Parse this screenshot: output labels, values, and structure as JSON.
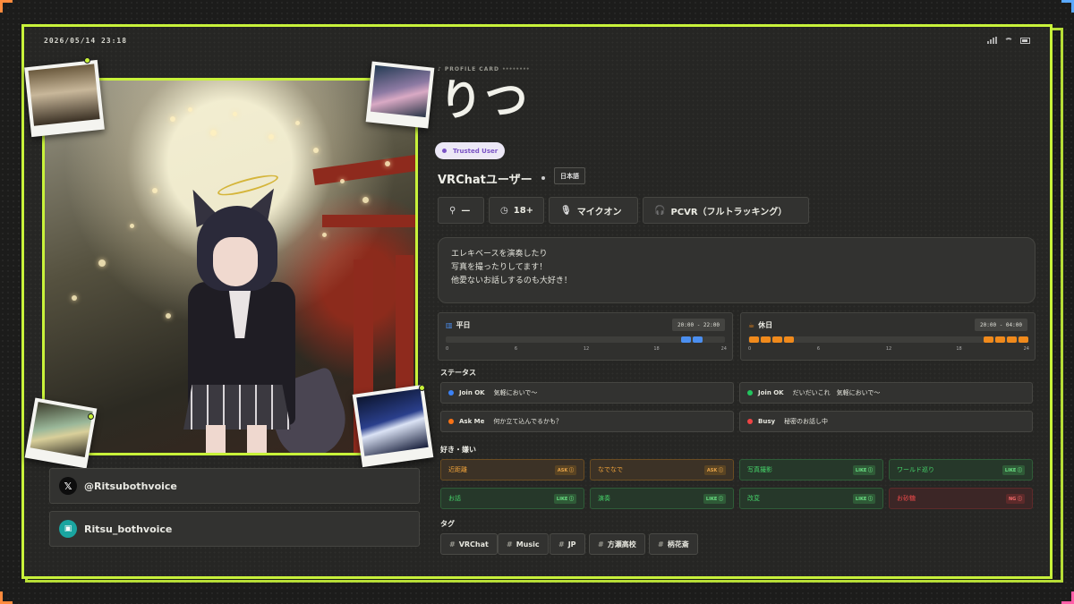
{
  "status_bar": {
    "time": "2026/05/14 23:18"
  },
  "kicker": "PROFILE CARD",
  "name": "りつ",
  "trust_badge": "Trusted User",
  "role": "VRChatユーザー",
  "language": "日本語",
  "chips": [
    {
      "icon": "person-icon",
      "label": "—"
    },
    {
      "icon": "age-icon",
      "label": "18+"
    },
    {
      "icon": "microphone-icon",
      "label": "マイクオン"
    },
    {
      "icon": "headset-icon",
      "label": "PCVR（フルトラッキング）"
    }
  ],
  "bio": [
    "エレキベースを演奏したり",
    "写真を撮ったりしてます！",
    "他愛ないお話しするのも大好き！"
  ],
  "schedule": {
    "weekday": {
      "label": "平日",
      "time": "20:00 - 22:00",
      "color": "#4b8ff0",
      "ranges": [
        [
          20,
          22
        ]
      ]
    },
    "holiday": {
      "label": "休日",
      "time": "20:00 - 04:00",
      "color": "#f08a1c",
      "ranges": [
        [
          0,
          4
        ],
        [
          20,
          24
        ]
      ]
    },
    "ticks": [
      "0",
      "6",
      "12",
      "18",
      "24"
    ]
  },
  "sections": {
    "status": "ステータス",
    "likes": "好き・嫌い",
    "tags": "タグ"
  },
  "statuses": [
    {
      "state": "Join OK",
      "message": "気軽においで〜",
      "color": "#3b82f6"
    },
    {
      "state": "Join OK",
      "message": "だいだいこれ　気軽においで〜",
      "color": "#22c55e"
    },
    {
      "state": "Ask Me",
      "message": "何か立て込んでるかも？",
      "color": "#f97316"
    },
    {
      "state": "Busy",
      "message": "秘密のお話し中",
      "color": "#ef4444"
    }
  ],
  "likes": [
    {
      "label": "近距離",
      "badge": "ASK ⓘ",
      "kind": "ask"
    },
    {
      "label": "なでなで",
      "badge": "ASK ⓘ",
      "kind": "ask"
    },
    {
      "label": "写真撮影",
      "badge": "LIKE ⓘ",
      "kind": "like"
    },
    {
      "label": "ワールド巡り",
      "badge": "LIKE ⓘ",
      "kind": "like"
    },
    {
      "label": "お話",
      "badge": "LIKE ⓘ",
      "kind": "like"
    },
    {
      "label": "演奏",
      "badge": "LIKE ⓘ",
      "kind": "like"
    },
    {
      "label": "改変",
      "badge": "LIKE ⓘ",
      "kind": "like"
    },
    {
      "label": "お砂糖",
      "badge": "NG ⓘ",
      "kind": "ng"
    }
  ],
  "tags": [
    "VRChat",
    "Music",
    "JP",
    "方瀬高校",
    "柄花斎"
  ],
  "social": [
    {
      "icon": "x-logo-icon",
      "handle": "@Ritsubothvoice"
    },
    {
      "icon": "vrchat-logo-icon",
      "handle": "Ritsu_bothvoice"
    }
  ],
  "colors": {
    "accent": "#c8f23a",
    "background": "#262624"
  }
}
